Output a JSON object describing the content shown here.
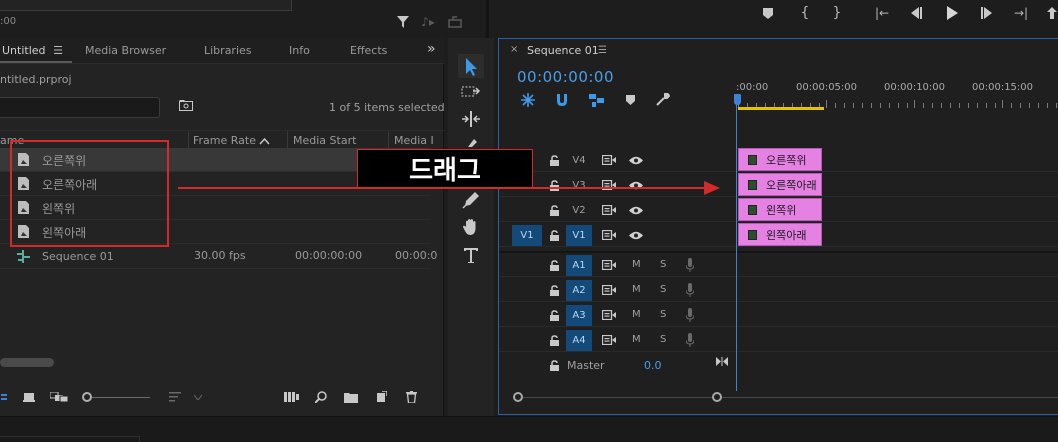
{
  "source_monitor": {
    "timecode": ":00"
  },
  "project": {
    "tabs": [
      "Untitled",
      "Media Browser",
      "Libraries",
      "Info",
      "Effects"
    ],
    "more": "»",
    "file": "ntitled.prproj",
    "items_count": "1 of 5 items selected",
    "columns": [
      "ame",
      "Frame Rate",
      "Media Start",
      "Media I"
    ],
    "items": [
      {
        "name": "오른쪽위",
        "frame_rate": "",
        "media_start": "",
        "media_end": ""
      },
      {
        "name": "오른쪽아래",
        "frame_rate": "",
        "media_start": "",
        "media_end": ""
      },
      {
        "name": "왼쪽위",
        "frame_rate": "",
        "media_start": "",
        "media_end": ""
      },
      {
        "name": "왼쪽아래",
        "frame_rate": "",
        "media_start": "",
        "media_end": ""
      },
      {
        "name": "Sequence 01",
        "frame_rate": "30.00 fps",
        "media_start": "00:00:00:00",
        "media_end": "00:00:0"
      }
    ]
  },
  "annotation": {
    "drag_label": "드래그"
  },
  "timeline": {
    "sequence_name": "Sequence 01",
    "close": "×",
    "menu": "☰",
    "timecode": "00:00:00:00",
    "ruler_labels": [
      ":00:00",
      "00:00:05:00",
      "00:00:10:00",
      "00:00:15:00"
    ],
    "video_tracks": [
      {
        "name": "V4",
        "source": "",
        "clip": "오른쪽위"
      },
      {
        "name": "V3",
        "source": "",
        "clip": "오른쪽아래"
      },
      {
        "name": "V2",
        "source": "",
        "clip": "왼쪽위"
      },
      {
        "name": "V1",
        "source": "V1",
        "clip": "왼쪽아래"
      }
    ],
    "audio_tracks": [
      {
        "name": "A1",
        "m": "M",
        "s": "S"
      },
      {
        "name": "A2",
        "m": "M",
        "s": "S"
      },
      {
        "name": "A3",
        "m": "M",
        "s": "S"
      },
      {
        "name": "A4",
        "m": "M",
        "s": "S"
      }
    ],
    "master": {
      "label": "Master",
      "value": "0.0"
    }
  },
  "colors": {
    "accent": "#4a9ee8",
    "clip": "#e481e3",
    "annotation_red": "#d42a2a",
    "track_on": "#134a7a"
  }
}
